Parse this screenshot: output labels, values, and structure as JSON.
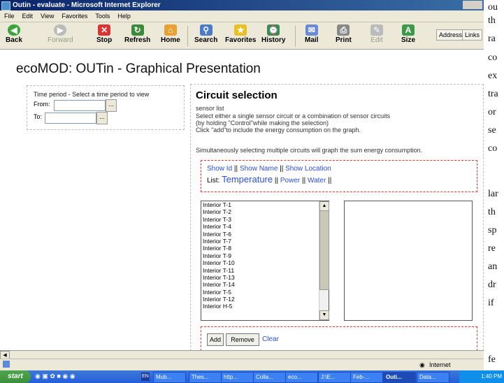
{
  "window": {
    "title": "Outin - evaluate - Microsoft Internet Explorer"
  },
  "menu": [
    "File",
    "Edit",
    "View",
    "Favorites",
    "Tools",
    "Help"
  ],
  "toolbar": {
    "back": "Back",
    "forward": "Forward",
    "stop": "Stop",
    "refresh": "Refresh",
    "home": "Home",
    "search": "Search",
    "favorites": "Favorites",
    "history": "History",
    "mail": "Mail",
    "print": "Print",
    "edit": "Edit",
    "size": "Size",
    "address": "Address",
    "links": "Links"
  },
  "page": {
    "title": "ecoMOD: OUTin - Graphical Presentation",
    "time_period": {
      "heading": "Time period - Select a time period to view",
      "from": "From:",
      "to": "To:",
      "from_value": "",
      "to_value": "",
      "picker_label": "..."
    },
    "circuit": {
      "title": "Circuit selection",
      "sensor_list": "sensor list",
      "instr1": "Select either a single sensor circuit or a combination of sensor circuits",
      "instr2": "(by holding \"Control\"while making the selection)",
      "instr3": "Click \"add\"to include the energy consumption on the graph.",
      "instr4": "Simultaneously selecting multiple circuits will graph the sum energy consumption.",
      "show_id": "Show Id",
      "show_name": "Show Name",
      "show_location": "Show Location",
      "sep": "||",
      "list_label": "List:",
      "temperature": "Temperature",
      "power": "Power",
      "water": "Water",
      "sensors": [
        "Interior T-1",
        "Interior T-2",
        "Interior T-3",
        "Interior T-4",
        "Interior T-6",
        "Interior T-7",
        "Interior T-8",
        "Interior T-9",
        "Interior T-10",
        "Interior T-11",
        "Interior T-13",
        "Interior T-14",
        "Interior T-5",
        "Interior T-12",
        "Interior H-5"
      ],
      "add": "Add",
      "remove": "Remove",
      "clear": "Clear"
    }
  },
  "status": {
    "zone": "Internet"
  },
  "taskbar": {
    "start": "start",
    "lang": "EN",
    "tasks": [
      "Mub...",
      "Thes...",
      "http...",
      "Colla...",
      "eco...",
      "J:\\E...",
      "Feb-...",
      "Outi...",
      "Data..."
    ],
    "clock": "1:40 PM"
  },
  "background_text": [
    "ou",
    "th",
    "ra",
    "co",
    "ex",
    "tra",
    "or",
    "se",
    "co",
    "lar",
    "th",
    "sp",
    "re",
    "an",
    "dr",
    "if",
    "fe"
  ]
}
